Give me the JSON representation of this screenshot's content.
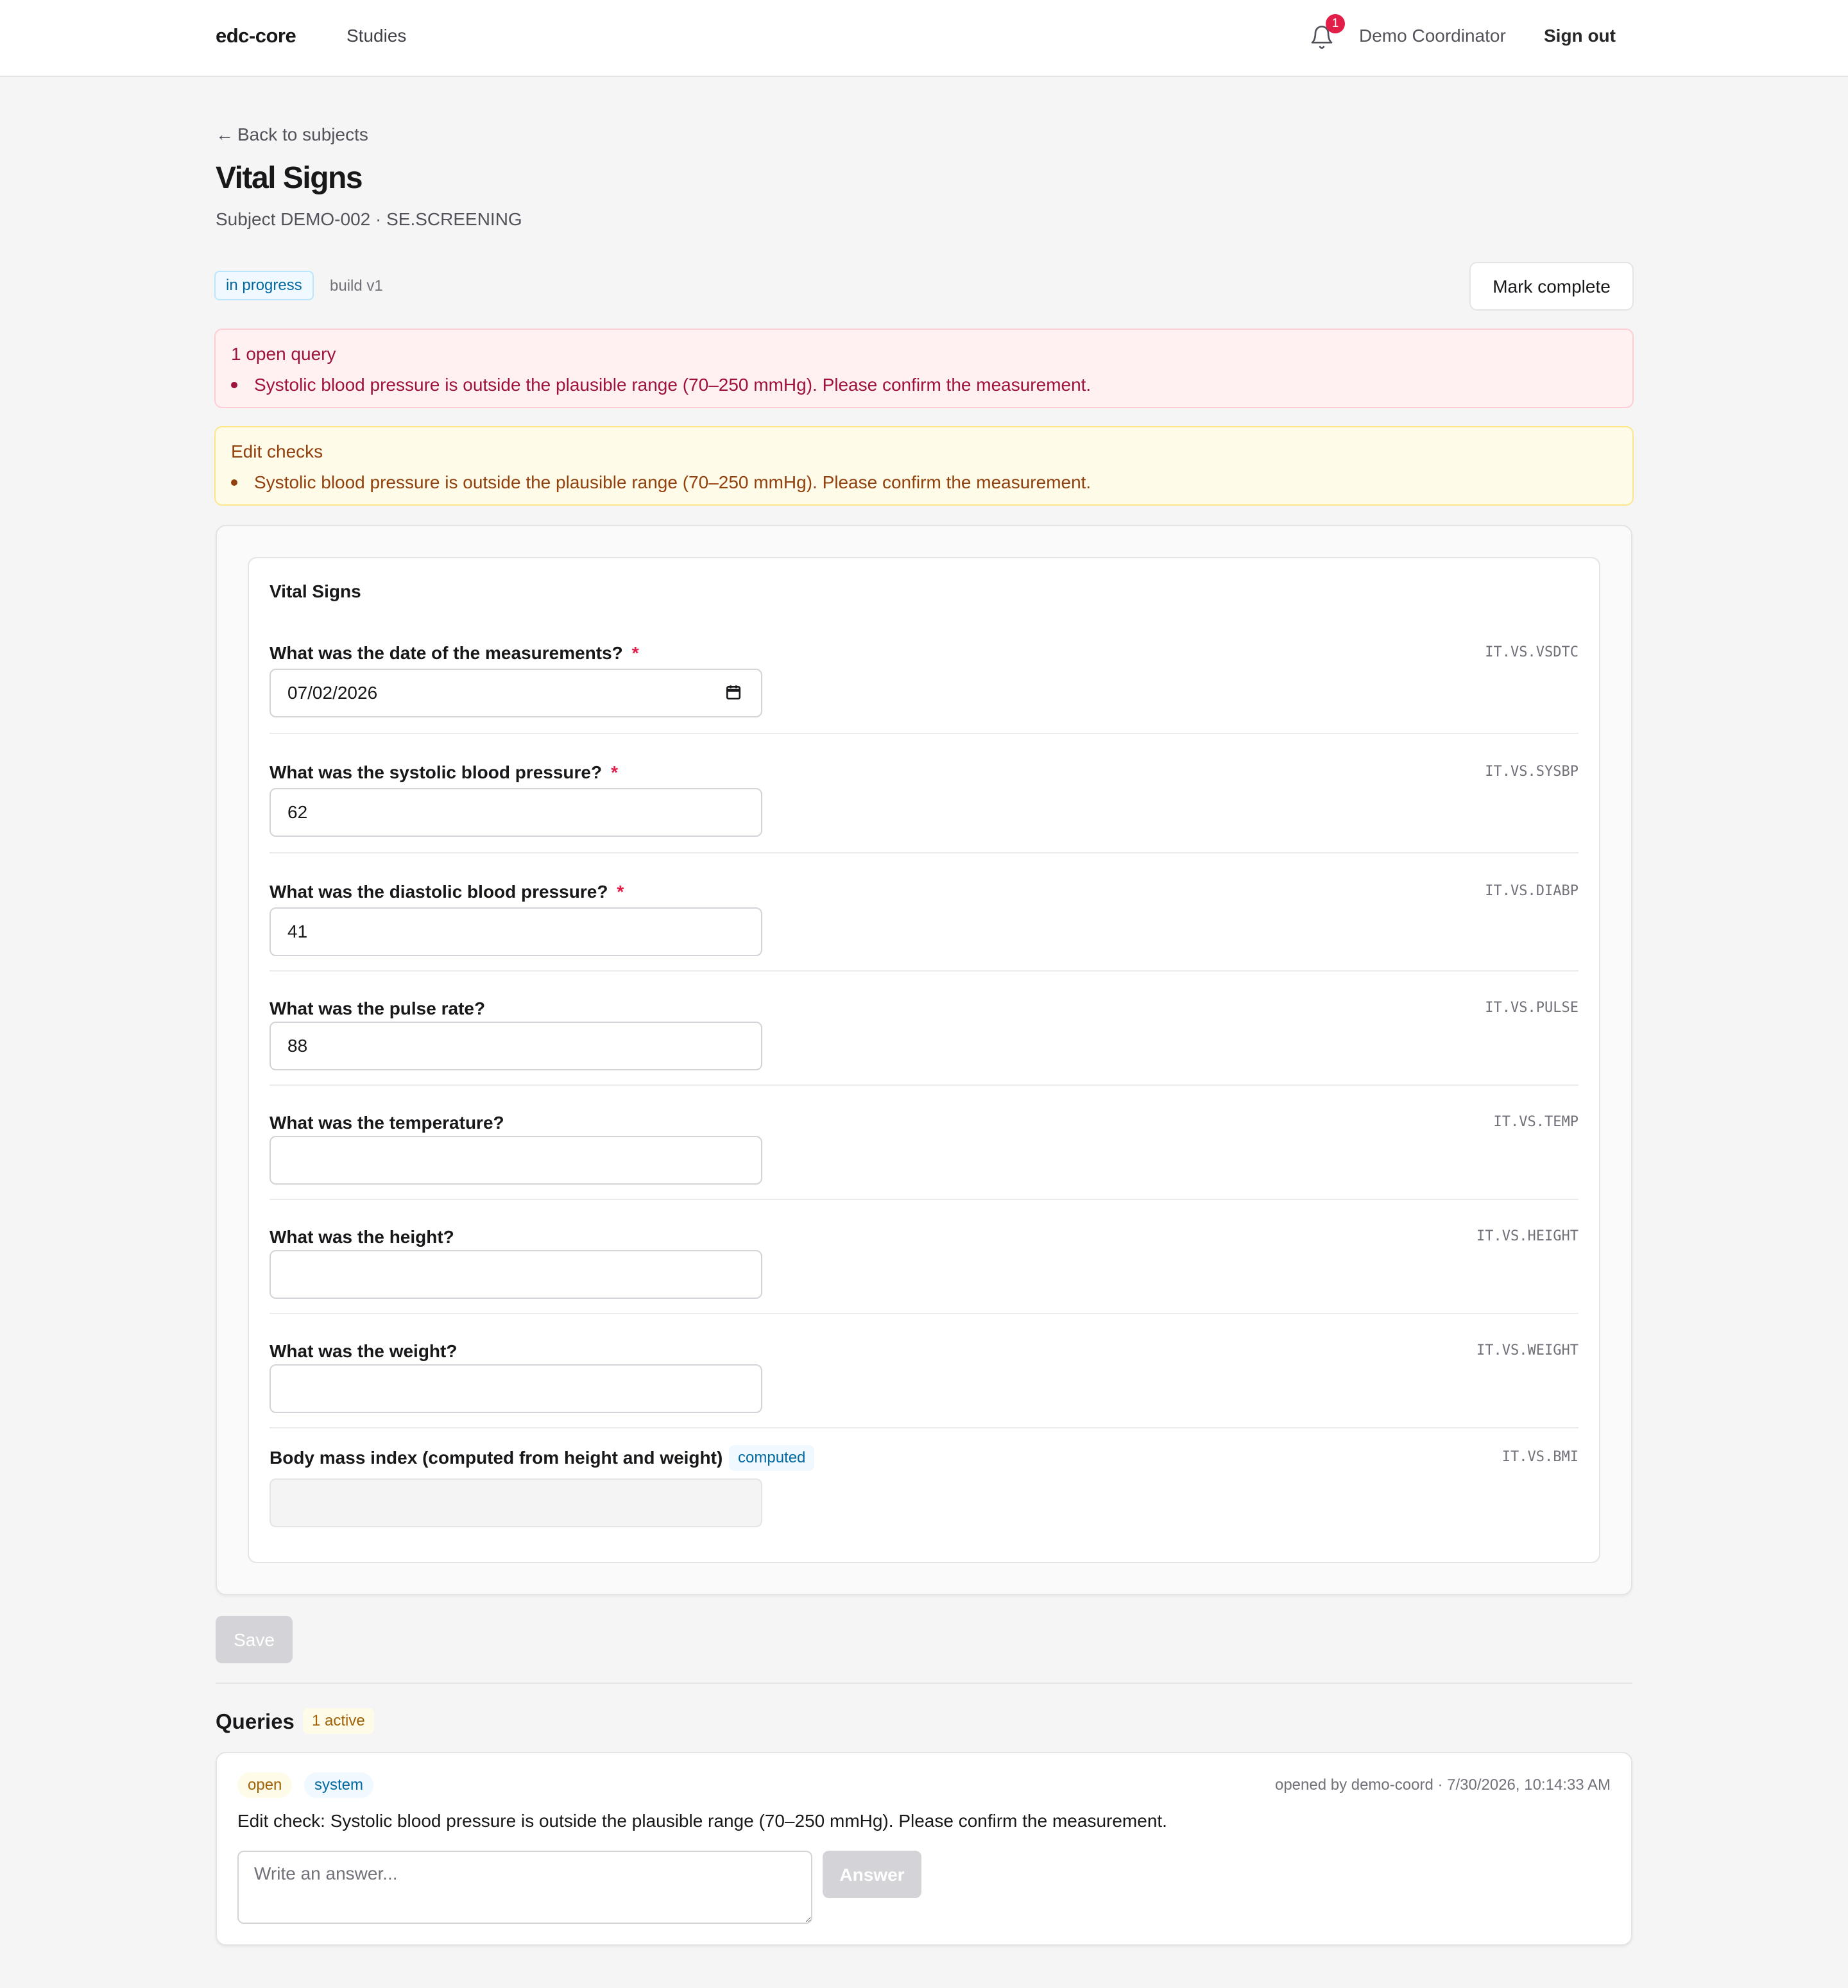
{
  "header": {
    "brand": "edc-core",
    "nav_studies": "Studies",
    "notification_count": "1",
    "user_name": "Demo Coordinator",
    "sign_out": "Sign out",
    "bell_icon": "bell-icon"
  },
  "page": {
    "back_link": "Back to subjects",
    "title": "Vital Signs",
    "subtitle": "Subject DEMO-002 · SE.SCREENING",
    "status": "in progress",
    "build": "build v1",
    "mark_complete": "Mark complete"
  },
  "alerts": {
    "query_title": "1 open query",
    "query_item": "Systolic blood pressure is outside the plausible range (70–250 mmHg). Please confirm the measurement.",
    "edit_title": "Edit checks",
    "edit_item": "Systolic blood pressure is outside the plausible range (70–250 mmHg). Please confirm the measurement."
  },
  "form": {
    "section_title": "Vital Signs",
    "required_marker": "*",
    "questions": [
      {
        "label": "What was the date of the measurements?",
        "code": "IT.VS.VSDTC",
        "value": "07/02/2026",
        "required": true
      },
      {
        "label": "What was the systolic blood pressure?",
        "code": "IT.VS.SYSBP",
        "value": "62",
        "required": true
      },
      {
        "label": "What was the diastolic blood pressure?",
        "code": "IT.VS.DIABP",
        "value": "41",
        "required": true
      },
      {
        "label": "What was the pulse rate?",
        "code": "IT.VS.PULSE",
        "value": "88",
        "required": false
      },
      {
        "label": "What was the temperature?",
        "code": "IT.VS.TEMP",
        "value": "",
        "required": false
      },
      {
        "label": "What was the height?",
        "code": "IT.VS.HEIGHT",
        "value": "",
        "required": false
      },
      {
        "label": "What was the weight?",
        "code": "IT.VS.WEIGHT",
        "value": "",
        "required": false
      },
      {
        "label": "Body mass index (computed from height and weight)",
        "code": "IT.VS.BMI",
        "value": "",
        "required": false,
        "badge": "computed"
      }
    ],
    "save": "Save"
  },
  "queries": {
    "title": "Queries",
    "active_count": "1 active",
    "items": [
      {
        "status": "open",
        "source": "system",
        "meta": "opened by demo-coord · 7/30/2026, 10:14:33 AM",
        "text": "Edit check: Systolic blood pressure is outside the plausible range (70–250 mmHg). Please confirm the measurement.",
        "answer_placeholder": "Write an answer...",
        "answer_button": "Answer"
      }
    ]
  },
  "colors": {
    "accent": "#0369a1",
    "danger": "#e11d48",
    "query_bg": "#fff1f2",
    "edit_bg": "#fefce8"
  }
}
